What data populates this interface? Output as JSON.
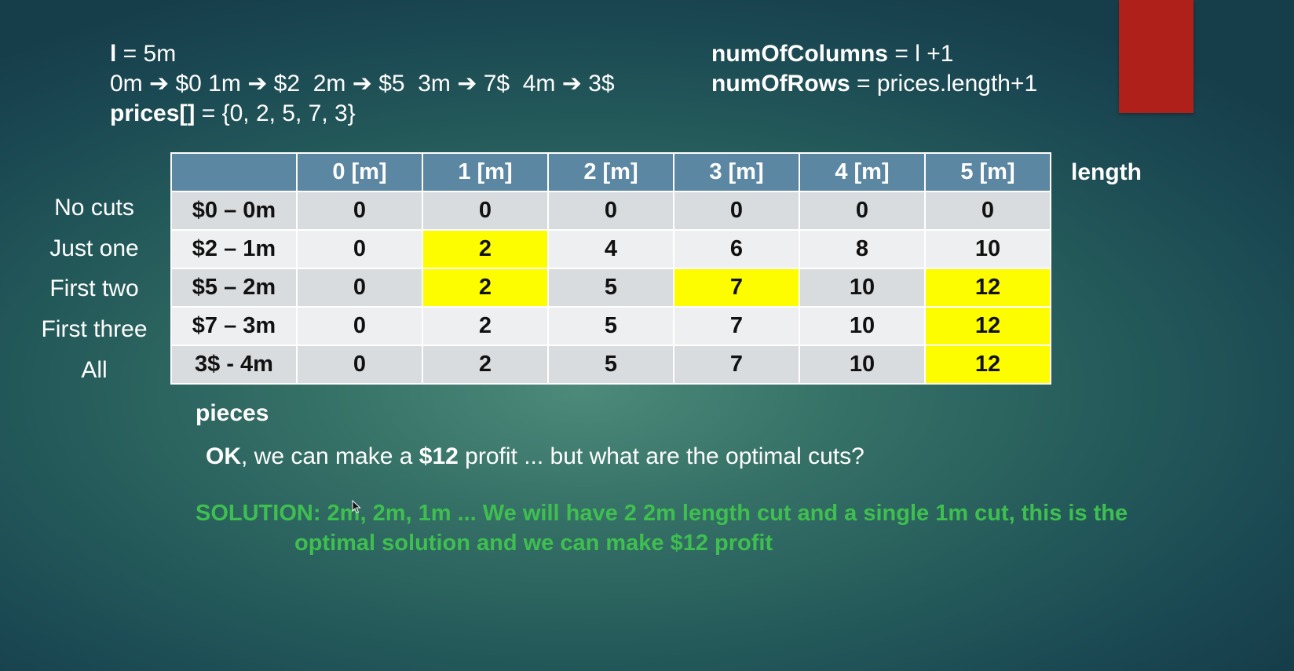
{
  "header": {
    "line1_var": "l",
    "line1_rest": " = 5m",
    "line2": "0m ➔ $0 1m ➔ $2  2m ➔ $5  3m ➔ 7$  4m ➔ 3$",
    "line3_var": "prices[]",
    "line3_rest": " = {0, 2, 5, 7, 3}",
    "cols_var": "numOfColumns",
    "cols_rest": " = l +1",
    "rows_var": "numOfRows",
    "rows_rest": " = prices.length+1"
  },
  "table": {
    "corner": "",
    "columns": [
      "0 [m]",
      "1 [m]",
      "2 [m]",
      "3 [m]",
      "4 [m]",
      "5 [m]"
    ],
    "axis_label": "length",
    "pieces_label": "pieces",
    "rows": [
      {
        "label": "No cuts",
        "price": "$0 – 0m",
        "cells": [
          "0",
          "0",
          "0",
          "0",
          "0",
          "0"
        ],
        "highlight": []
      },
      {
        "label": "Just one",
        "price": "$2 – 1m",
        "cells": [
          "0",
          "2",
          "4",
          "6",
          "8",
          "10"
        ],
        "highlight": [
          1
        ]
      },
      {
        "label": "First two",
        "price": "$5 – 2m",
        "cells": [
          "0",
          "2",
          "5",
          "7",
          "10",
          "12"
        ],
        "highlight": [
          1,
          3,
          5
        ]
      },
      {
        "label": "First three",
        "price": "$7 – 3m",
        "cells": [
          "0",
          "2",
          "5",
          "7",
          "10",
          "12"
        ],
        "highlight": [
          5
        ]
      },
      {
        "label": "All",
        "price": "3$ - 4m",
        "cells": [
          "0",
          "2",
          "5",
          "7",
          "10",
          "12"
        ],
        "highlight": [
          5
        ]
      }
    ],
    "highlight_color": "#fdfd00"
  },
  "question": {
    "ok": "OK",
    "part1": ", we can make a ",
    "amount": "$12",
    "part2": " profit ... but what are the optimal cuts?"
  },
  "solution": {
    "line1": "SOLUTION: 2m, 2m, 1m ... We will have 2 2m length cut and a single 1m cut, this is the",
    "line2": "optimal solution and we can make $12 profit",
    "color": "#3fbf4f"
  },
  "colors": {
    "accent_block": "#b0201a",
    "table_header": "#5b87a3"
  }
}
